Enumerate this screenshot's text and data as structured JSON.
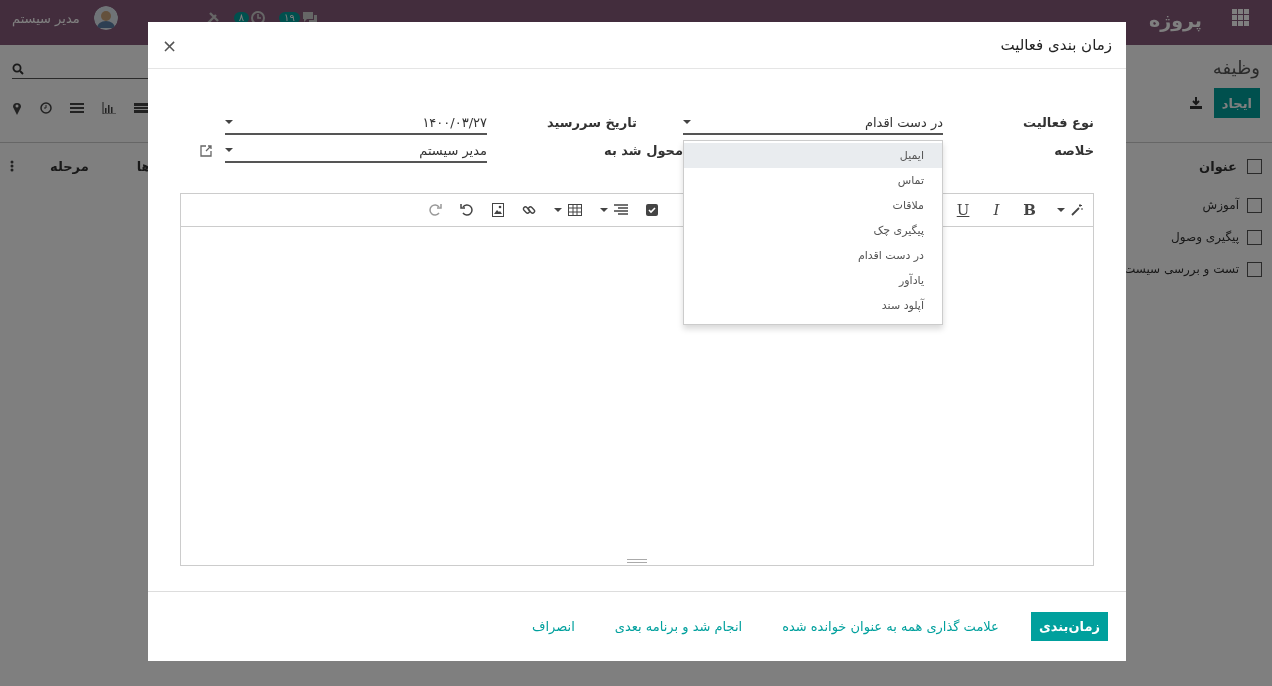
{
  "navbar": {
    "app_title": "پروژه",
    "user_name": "مدیر سیستم",
    "badges": [
      {
        "count": "۱۹",
        "kind": "chat"
      },
      {
        "count": "۸",
        "kind": "clock"
      }
    ]
  },
  "page": {
    "breadcrumb": "وظیفه",
    "create_button": "ایجاد",
    "columns": [
      "عنوان",
      "ها",
      "مرحله"
    ],
    "select_all_checked": false,
    "rows": [
      {
        "title": "آموزش",
        "checked": false
      },
      {
        "title": "پیگیری وصول",
        "checked": false
      },
      {
        "title": "تست و بررسی سیست",
        "checked": false
      }
    ]
  },
  "dialog": {
    "title": "زمان بندی فعالیت",
    "close": "×",
    "activity_type": {
      "label": "نوع فعالیت",
      "value": "در دست اقدام"
    },
    "summary": {
      "label": "خلاصه"
    },
    "due_date": {
      "label": "تاریخ سررسید",
      "value": "۱۴۰۰/۰۳/۲۷"
    },
    "assigned_to": {
      "label": "محول شد به",
      "value": "مدیر سیستم"
    },
    "format_buttons": [
      "B",
      "I",
      "U"
    ],
    "options": [
      {
        "label": "ایمیل",
        "selected": true
      },
      {
        "label": "تماس",
        "selected": false
      },
      {
        "label": "ملاقات",
        "selected": false
      },
      {
        "label": "پیگیری چک",
        "selected": false
      },
      {
        "label": "در دست اقدام",
        "selected": false
      },
      {
        "label": "یادآور",
        "selected": false
      },
      {
        "label": "آپلود سند",
        "selected": false
      }
    ],
    "buttons": [
      {
        "label": "زمان‌بندی",
        "kind": "primary"
      },
      {
        "label": "علامت گذاری همه به عنوان خوانده شده",
        "kind": "link"
      },
      {
        "label": "انجام شد و برنامه بعدی",
        "kind": "link"
      },
      {
        "label": "انصراف",
        "kind": "link"
      }
    ]
  }
}
